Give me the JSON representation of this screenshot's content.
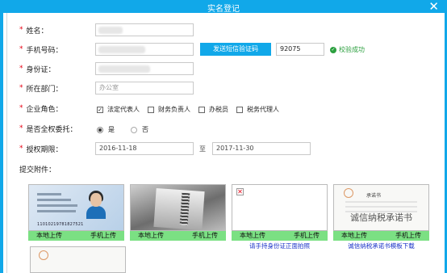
{
  "window": {
    "title": "实名登记",
    "close_glyph": "✕"
  },
  "form": {
    "required_mark": "*",
    "name": {
      "label": "姓名："
    },
    "phone": {
      "label": "手机号码：",
      "sms_button": "发送短信验证码",
      "code_value": "92075",
      "verify_status": "校验成功",
      "verify_icon": "check-circle-icon"
    },
    "id_number": {
      "label": "身份证："
    },
    "department": {
      "label": "所在部门：",
      "placeholder": "办公室"
    },
    "role": {
      "label": "企业角色：",
      "options": [
        {
          "label": "法定代表人",
          "checked": true
        },
        {
          "label": "财务负责人",
          "checked": false
        },
        {
          "label": "办税员",
          "checked": false
        },
        {
          "label": "税务代理人",
          "checked": false
        }
      ]
    },
    "full_authority": {
      "label": "是否全权委托：",
      "options": [
        {
          "label": "是",
          "selected": true
        },
        {
          "label": "否",
          "selected": false
        }
      ]
    },
    "auth_period": {
      "label": "授权期限：",
      "start": "2016-11-18",
      "separator": "至",
      "end": "2017-11-30"
    },
    "attachments_label": "提交附件："
  },
  "attachments": {
    "local_upload": "本地上传",
    "mobile_upload": "手机上传",
    "cards": [
      {
        "id_sample_number": "11010219781827521",
        "link": ""
      },
      {
        "link": ""
      },
      {
        "broken_glyph": "✕",
        "link": "请手持身份证正面拍照"
      },
      {
        "letter_heading": "承诺书",
        "letter_title": "诚信纳税承诺书",
        "link": "诚信纳税承诺书模板下载"
      }
    ]
  },
  "colors": {
    "accent": "#11a8e9",
    "required": "#e60012",
    "success": "#2b9f3e",
    "upload_bar": "#7be083",
    "link": "#1a33c8"
  }
}
